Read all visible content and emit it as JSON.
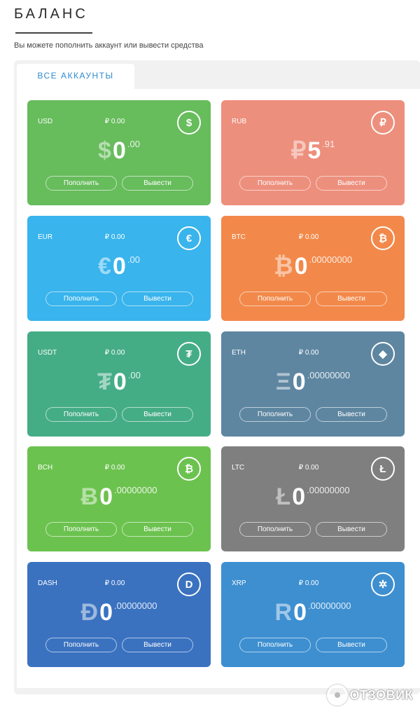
{
  "page": {
    "title": "БАЛАНС",
    "subtitle": "Вы можете пополнить аккаунт или вывести средства"
  },
  "tabs": [
    {
      "label": "ВСЕ АККАУНТЫ"
    }
  ],
  "buttons": {
    "deposit": "Пополнить",
    "withdraw": "Вывести"
  },
  "accounts": [
    {
      "code": "USD",
      "balance": "₽ 0.00",
      "symbol": "$",
      "int": "0",
      "dec": ".00",
      "icon": "dollar-icon",
      "glyph": "$",
      "color": "#67bc5c"
    },
    {
      "code": "RUB",
      "balance": "",
      "symbol": "₽",
      "int": "5",
      "dec": ".91",
      "icon": "ruble-icon",
      "glyph": "₽",
      "color": "#ed8f7d"
    },
    {
      "code": "EUR",
      "balance": "₽ 0.00",
      "symbol": "€",
      "int": "0",
      "dec": ".00",
      "icon": "euro-icon",
      "glyph": "€",
      "color": "#39b4ec"
    },
    {
      "code": "BTC",
      "balance": "₽ 0.00",
      "symbol": "₿",
      "int": "0",
      "dec": ".00000000",
      "icon": "bitcoin-icon",
      "glyph": "₿",
      "color": "#f2894a"
    },
    {
      "code": "USDT",
      "balance": "₽ 0.00",
      "symbol": "₮",
      "int": "0",
      "dec": ".00",
      "icon": "tether-icon",
      "glyph": "₮",
      "color": "#45ad86"
    },
    {
      "code": "ETH",
      "balance": "₽ 0.00",
      "symbol": "Ξ",
      "int": "0",
      "dec": ".00000000",
      "icon": "ethereum-icon",
      "glyph": "◆",
      "color": "#5e86a1"
    },
    {
      "code": "BCH",
      "balance": "₽ 0.00",
      "symbol": "Ƀ",
      "int": "0",
      "dec": ".00000000",
      "icon": "bitcoin-cash-icon",
      "glyph": "₿",
      "color": "#6cc24f"
    },
    {
      "code": "LTC",
      "balance": "₽ 0.00",
      "symbol": "Ł",
      "int": "0",
      "dec": ".00000000",
      "icon": "litecoin-icon",
      "glyph": "Ł",
      "color": "#7f7f7f"
    },
    {
      "code": "DASH",
      "balance": "₽ 0.00",
      "symbol": "Đ",
      "int": "0",
      "dec": ".00000000",
      "icon": "dash-icon",
      "glyph": "D",
      "color": "#3a72c0"
    },
    {
      "code": "XRP",
      "balance": "₽ 0.00",
      "symbol": "R",
      "int": "0",
      "dec": ".00000000",
      "icon": "ripple-icon",
      "glyph": "✲",
      "color": "#3d8fd0"
    }
  ],
  "watermark": {
    "text": "ОТЗОВИК"
  }
}
